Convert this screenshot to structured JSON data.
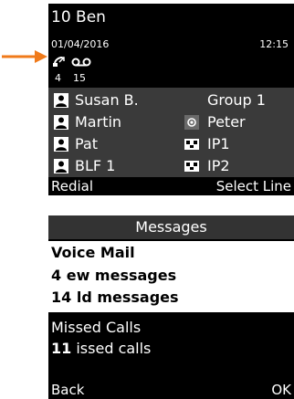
{
  "screen1": {
    "header": "10 Ben",
    "date": "01/04/2016",
    "time": "12:15",
    "missed_count": "4",
    "voicemail_count": "15",
    "lines": [
      {
        "left": "Susan B.",
        "right": "Group 1"
      },
      {
        "left": "Martin",
        "right": "Peter"
      },
      {
        "left": "Pat",
        "right": "IP1"
      },
      {
        "left": "BLF 1",
        "right": "IP2"
      }
    ],
    "softkey_left": "Redial",
    "softkey_right": "Select Line"
  },
  "screen2": {
    "title": "Messages",
    "voicemail": {
      "title": "Voice Mail",
      "new_count": "4",
      "new_label": "ew messages",
      "old_count": "14",
      "old_label": "ld messages"
    },
    "missed": {
      "title": "Missed Calls",
      "count": "11",
      "label": "issed calls"
    },
    "softkey_left": "Back",
    "softkey_right": "OK"
  },
  "colors": {
    "arrow": "#f07a1a",
    "screen_bg": "#000000",
    "grid_bg": "#3a3a3a",
    "header_bg": "#333333"
  },
  "icons": [
    "arrow-right-icon",
    "missed-call-icon",
    "voicemail-icon",
    "person-icon",
    "email-icon",
    "network-icon"
  ]
}
